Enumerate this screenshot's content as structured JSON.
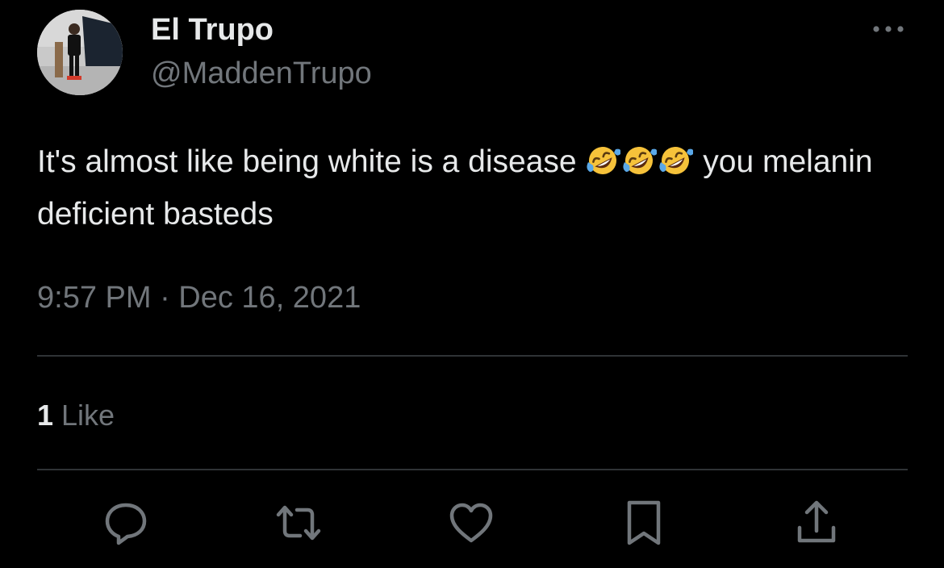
{
  "author": {
    "display_name": "El Trupo",
    "handle": "@MaddenTrupo"
  },
  "tweet": {
    "text_before_emoji": "It's almost like being white is a disease ",
    "emoji_count": 3,
    "emoji_icon": "rolling-on-floor-laughing-emoji",
    "text_after_emoji": " you melanin deficient basteds"
  },
  "timestamp": "9:57 PM · Dec 16, 2021",
  "engagement": {
    "likes_count": "1",
    "likes_label": " Like"
  },
  "actions": {
    "reply_icon": "reply-icon",
    "retweet_icon": "retweet-icon",
    "like_icon": "heart-icon",
    "bookmark_icon": "bookmark-icon",
    "share_icon": "share-icon"
  },
  "colors": {
    "background": "#000000",
    "primary_text": "#e7e9ea",
    "secondary_text": "#71767b",
    "divider": "#2f3336"
  }
}
